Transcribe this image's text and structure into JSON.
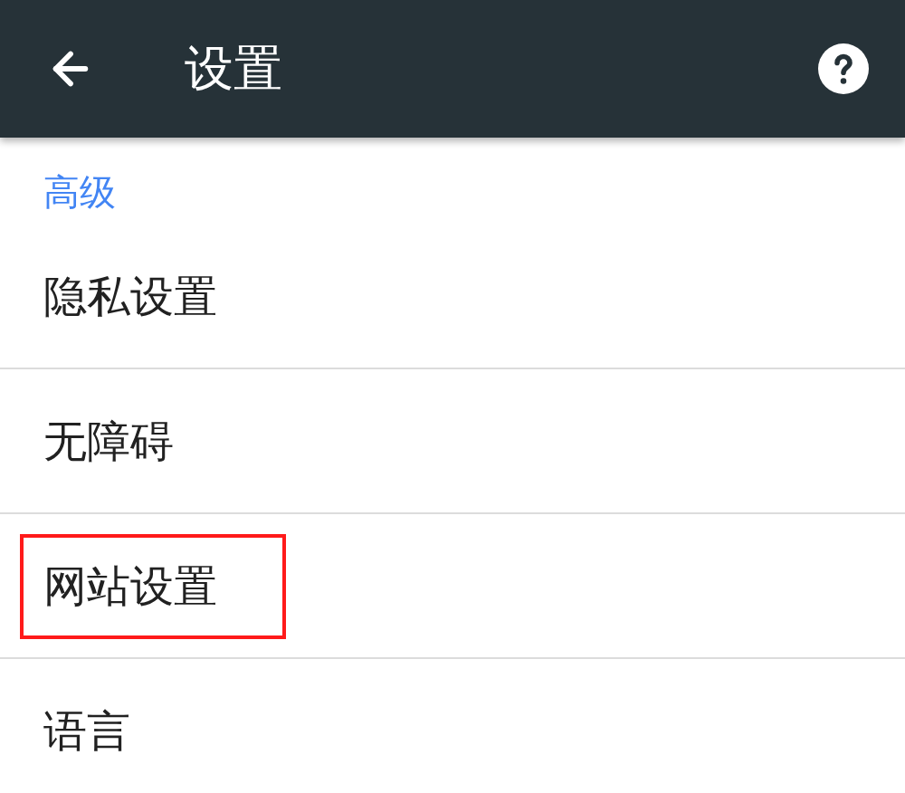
{
  "toolbar": {
    "title": "设置"
  },
  "section": {
    "header": "高级"
  },
  "items": [
    {
      "label": "隐私设置",
      "highlighted": false
    },
    {
      "label": "无障碍",
      "highlighted": false
    },
    {
      "label": "网站设置",
      "highlighted": true
    },
    {
      "label": "语言",
      "highlighted": false
    }
  ]
}
